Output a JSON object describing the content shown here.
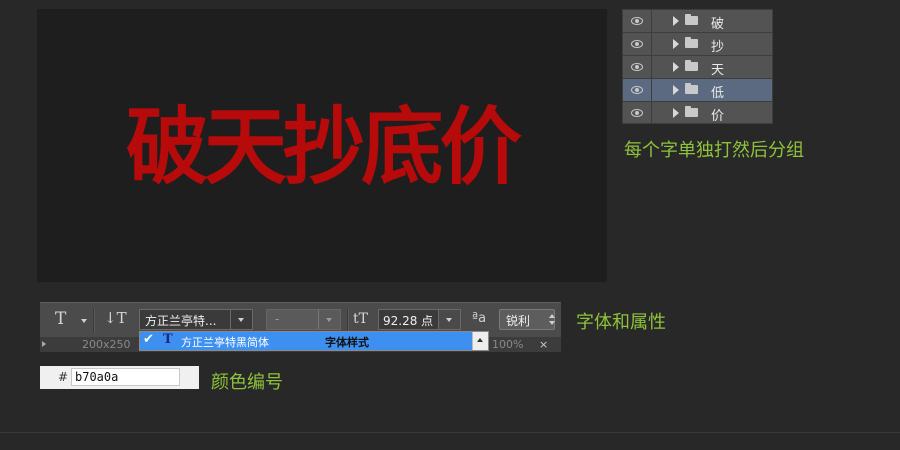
{
  "canvas": {
    "headline": "破天抄底价",
    "headline_color": "#b70a0a",
    "background": "#1e1e1e"
  },
  "layers": {
    "items": [
      {
        "name": "破",
        "selected": false
      },
      {
        "name": "抄",
        "selected": false
      },
      {
        "name": "天",
        "selected": false
      },
      {
        "name": "低",
        "selected": true
      },
      {
        "name": "价",
        "selected": false
      }
    ]
  },
  "annotations": {
    "layers_note": "每个字单独打然后分组",
    "toolbar_note": "字体和属性",
    "color_note": "颜色编号",
    "accent_color": "#8ec33a"
  },
  "toolbar": {
    "type_tool_icon": "T",
    "orientation_icon": "↓T",
    "font_family": "方正兰亭特...",
    "font_style": "-",
    "size_icon": "tT",
    "font_size": "92.28 点",
    "aa_icon": "ªa",
    "antialias": "锐利"
  },
  "doc_strip": {
    "doc_size": "200x250",
    "zoom": "100%",
    "close": "×"
  },
  "font_dropdown": {
    "check": "✔",
    "type_icon": "T",
    "font_name": "方正兰亭特黑简体",
    "sample": "字体样式"
  },
  "color_field": {
    "hash": "#",
    "hex": "b70a0a"
  }
}
